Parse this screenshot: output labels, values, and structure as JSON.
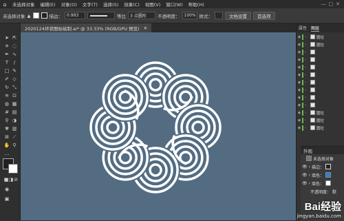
{
  "menubar": {
    "items": [
      "未选择对象",
      "编辑(E)",
      "对象(O)",
      "文字(T)",
      "选择(S)",
      "效果(C)",
      "视图(V)",
      "窗口(W)",
      "帮助(H)"
    ],
    "right_controls": [
      "—",
      "□",
      "✕"
    ]
  },
  "control_bar": {
    "selection_label": "未选择对象",
    "stroke_label": "描边：",
    "stroke_value": "0.993",
    "stroke_style_label": "等比",
    "brush_label": "3 点圆形",
    "opacity_label": "不透明度：",
    "opacity_value": "100%",
    "style_label": "样式：",
    "doc_setup_button": "文档设置",
    "prefs_button": "首选项"
  },
  "document_tab": {
    "title": "2020124环状图标绘制.ai* @ 33.33% (RGB/GPU 预览)",
    "close": "✕"
  },
  "right_panel": {
    "tabs": [
      "属性",
      "图层"
    ],
    "active_tab": "图层",
    "layers": [
      {
        "name": "圆拉"
      },
      {
        "name": "圆拉"
      },
      {
        "name": ""
      },
      {
        "name": ""
      },
      {
        "name": ""
      },
      {
        "name": ""
      },
      {
        "name": ""
      },
      {
        "name": ""
      },
      {
        "name": ""
      },
      {
        "name": ""
      },
      {
        "name": "圆拉"
      },
      {
        "name": "圆拉"
      },
      {
        "name": "圆拉"
      }
    ]
  },
  "appearance_panel": {
    "title": "外观",
    "object_label": "未选择对象",
    "rows": [
      "描边：",
      "填色：",
      "填色："
    ],
    "opacity_label": "不透明度：",
    "opacity_value": "默"
  },
  "watermark": {
    "brand": "Bai经验",
    "url": "jingyan.baidu.com"
  },
  "colors": {
    "canvas_bg": "#536c82",
    "artwork_fill": "#ffffff",
    "layer_color": "#6fb84a",
    "ui_dark": "#323232"
  }
}
